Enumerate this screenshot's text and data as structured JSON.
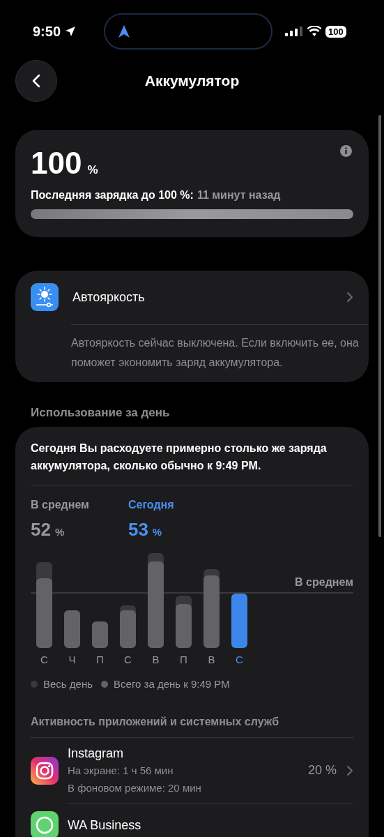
{
  "status_bar": {
    "time": "9:50",
    "battery": "100"
  },
  "header": {
    "title": "Аккумулятор"
  },
  "battery_card": {
    "percent": "100",
    "unit": "%",
    "last_charge_label": "Последняя зарядка до 100 %:",
    "last_charge_value": "11 минут назад",
    "level": 1.0
  },
  "auto_brightness": {
    "label": "Автояркость",
    "note": "Автояркость сейчас выключена. Если включить ее, она поможет экономить заряд аккумулятора."
  },
  "usage": {
    "section_title": "Использование за день",
    "summary": "Сегодня Вы расходуете примерно столько же заряда аккумулятора, сколько обычно к 9:49 PM.",
    "stats": [
      {
        "label": "В среднем",
        "value": "52",
        "unit": "%",
        "selected": false
      },
      {
        "label": "Сегодня",
        "value": "53",
        "unit": "%",
        "selected": true
      }
    ],
    "average_label": "В среднем",
    "days": [
      {
        "label": "С",
        "selected": false
      },
      {
        "label": "Ч",
        "selected": false
      },
      {
        "label": "П",
        "selected": false
      },
      {
        "label": "С",
        "selected": false
      },
      {
        "label": "В",
        "selected": false
      },
      {
        "label": "П",
        "selected": false
      },
      {
        "label": "В",
        "selected": false
      },
      {
        "label": "С",
        "selected": true
      }
    ],
    "legend": [
      "Весь день",
      "Всего за день к 9:49 PM"
    ],
    "apps_title": "Активность приложений и системных служб",
    "apps": [
      {
        "kind": "instagram",
        "name": "Instagram",
        "lines": [
          "На экране: 1 ч 56 мин",
          "В фоновом режиме: 20 мин"
        ],
        "percent": "20 %"
      },
      {
        "kind": "whatsapp",
        "name": "WA Business"
      }
    ]
  }
}
